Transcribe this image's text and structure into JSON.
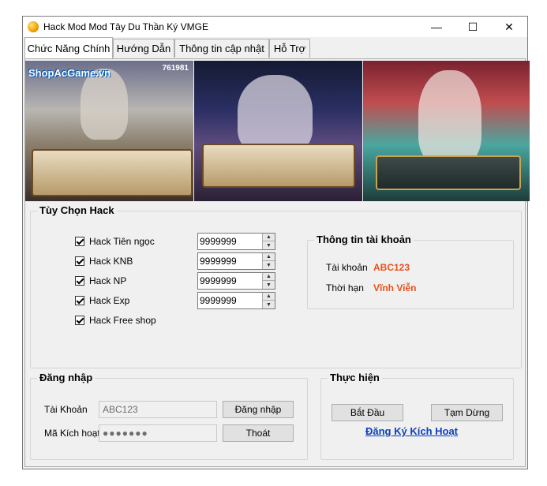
{
  "window": {
    "title": "Hack Mod Mod Tây Du Thần Ký VMGE"
  },
  "titlebar": {
    "minimize": "—",
    "maximize": "☐",
    "close": "✕"
  },
  "tabs": [
    {
      "label": "Chức Năng Chính",
      "active": true
    },
    {
      "label": "Hướng Dẫn",
      "active": false
    },
    {
      "label": "Thông tin cập nhật",
      "active": false
    },
    {
      "label": "Hỗ Trợ",
      "active": false
    }
  ],
  "banner": {
    "watermark": "ShopAcGame.vn",
    "score": "761981"
  },
  "hack_options": {
    "title": "Tùy Chọn Hack",
    "items": [
      {
        "label": "Hack Tiên ngọc",
        "checked": true,
        "value": "9999999"
      },
      {
        "label": "Hack KNB",
        "checked": true,
        "value": "9999999"
      },
      {
        "label": "Hack NP",
        "checked": true,
        "value": "9999999"
      },
      {
        "label": "Hack Exp",
        "checked": true,
        "value": "9999999"
      },
      {
        "label": "Hack Free shop",
        "checked": true
      }
    ]
  },
  "account_info": {
    "title": "Thông tin tài khoản",
    "account_label": "Tài khoản",
    "account_value": "ABC123",
    "expiry_label": "Thời hạn",
    "expiry_value": "Vĩnh Viễn"
  },
  "login": {
    "title": "Đăng nhập",
    "account_label": "Tài Khoản",
    "account_value": "ABC123",
    "key_label": "Mã Kích hoạt",
    "key_value": "●●●●●●●",
    "login_button": "Đăng nhập",
    "exit_button": "Thoát"
  },
  "execute": {
    "title": "Thực hiện",
    "start_button": "Bắt Đầu",
    "pause_button": "Tạm Dừng",
    "register_link": "Đăng Ký Kích Hoạt"
  },
  "colors": {
    "accent_value": "#e8501a",
    "link": "#0b3fbd"
  }
}
